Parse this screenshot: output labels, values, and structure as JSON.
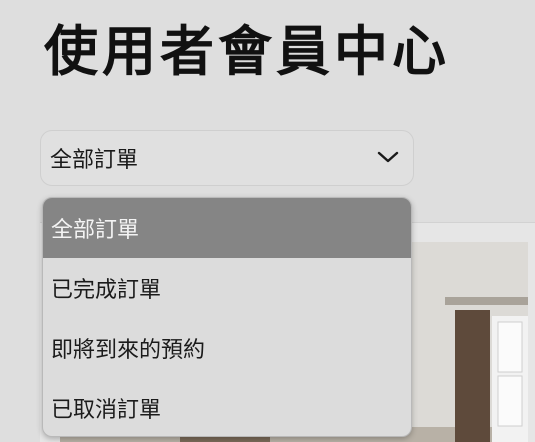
{
  "page": {
    "title": "使用者會員中心"
  },
  "filter": {
    "selected": "全部訂單",
    "options": [
      "全部訂單",
      "已完成訂單",
      "即將到來的預約",
      "已取消訂單"
    ]
  },
  "icons": {
    "dropdown": "chevron-down-icon"
  },
  "colors": {
    "selected_option_bg": "#858585",
    "menu_bg": "#dcdcdc",
    "page_bg": "#dedede"
  }
}
